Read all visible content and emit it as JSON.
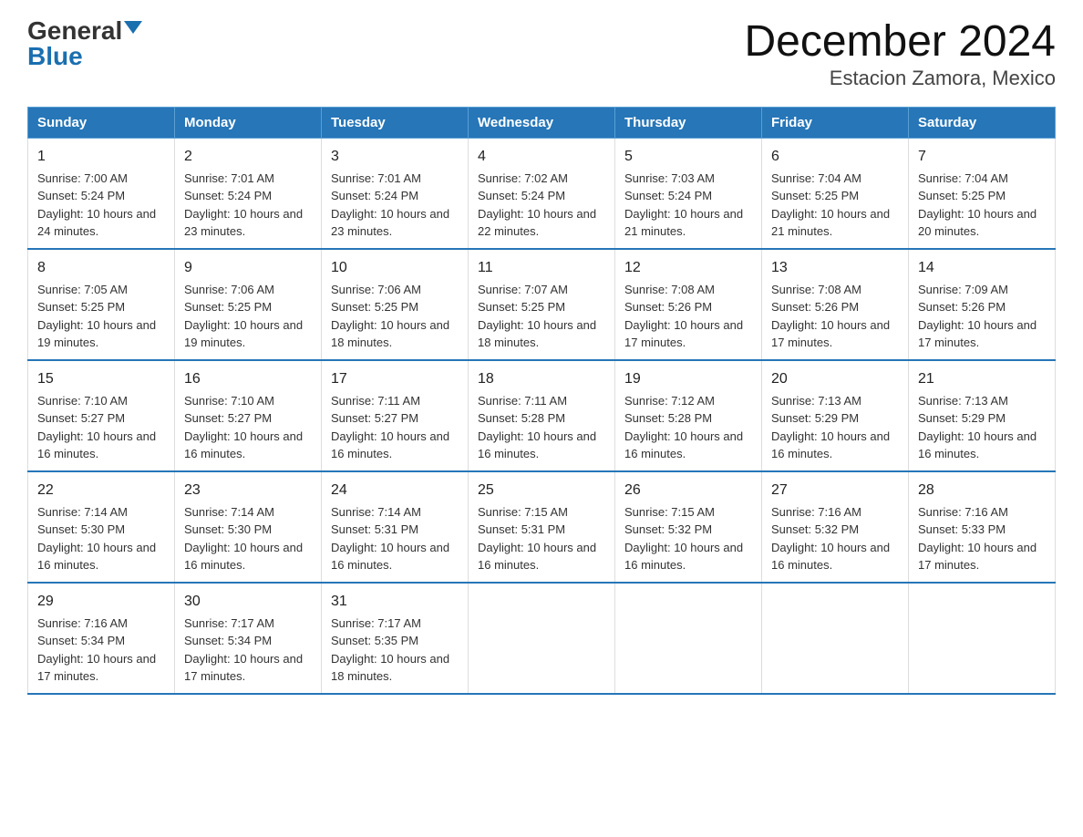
{
  "logo": {
    "general": "General",
    "blue": "Blue"
  },
  "title": "December 2024",
  "subtitle": "Estacion Zamora, Mexico",
  "days_of_week": [
    "Sunday",
    "Monday",
    "Tuesday",
    "Wednesday",
    "Thursday",
    "Friday",
    "Saturday"
  ],
  "weeks": [
    [
      {
        "day": "1",
        "sunrise": "7:00 AM",
        "sunset": "5:24 PM",
        "daylight": "10 hours and 24 minutes."
      },
      {
        "day": "2",
        "sunrise": "7:01 AM",
        "sunset": "5:24 PM",
        "daylight": "10 hours and 23 minutes."
      },
      {
        "day": "3",
        "sunrise": "7:01 AM",
        "sunset": "5:24 PM",
        "daylight": "10 hours and 23 minutes."
      },
      {
        "day": "4",
        "sunrise": "7:02 AM",
        "sunset": "5:24 PM",
        "daylight": "10 hours and 22 minutes."
      },
      {
        "day": "5",
        "sunrise": "7:03 AM",
        "sunset": "5:24 PM",
        "daylight": "10 hours and 21 minutes."
      },
      {
        "day": "6",
        "sunrise": "7:04 AM",
        "sunset": "5:25 PM",
        "daylight": "10 hours and 21 minutes."
      },
      {
        "day": "7",
        "sunrise": "7:04 AM",
        "sunset": "5:25 PM",
        "daylight": "10 hours and 20 minutes."
      }
    ],
    [
      {
        "day": "8",
        "sunrise": "7:05 AM",
        "sunset": "5:25 PM",
        "daylight": "10 hours and 19 minutes."
      },
      {
        "day": "9",
        "sunrise": "7:06 AM",
        "sunset": "5:25 PM",
        "daylight": "10 hours and 19 minutes."
      },
      {
        "day": "10",
        "sunrise": "7:06 AM",
        "sunset": "5:25 PM",
        "daylight": "10 hours and 18 minutes."
      },
      {
        "day": "11",
        "sunrise": "7:07 AM",
        "sunset": "5:25 PM",
        "daylight": "10 hours and 18 minutes."
      },
      {
        "day": "12",
        "sunrise": "7:08 AM",
        "sunset": "5:26 PM",
        "daylight": "10 hours and 17 minutes."
      },
      {
        "day": "13",
        "sunrise": "7:08 AM",
        "sunset": "5:26 PM",
        "daylight": "10 hours and 17 minutes."
      },
      {
        "day": "14",
        "sunrise": "7:09 AM",
        "sunset": "5:26 PM",
        "daylight": "10 hours and 17 minutes."
      }
    ],
    [
      {
        "day": "15",
        "sunrise": "7:10 AM",
        "sunset": "5:27 PM",
        "daylight": "10 hours and 16 minutes."
      },
      {
        "day": "16",
        "sunrise": "7:10 AM",
        "sunset": "5:27 PM",
        "daylight": "10 hours and 16 minutes."
      },
      {
        "day": "17",
        "sunrise": "7:11 AM",
        "sunset": "5:27 PM",
        "daylight": "10 hours and 16 minutes."
      },
      {
        "day": "18",
        "sunrise": "7:11 AM",
        "sunset": "5:28 PM",
        "daylight": "10 hours and 16 minutes."
      },
      {
        "day": "19",
        "sunrise": "7:12 AM",
        "sunset": "5:28 PM",
        "daylight": "10 hours and 16 minutes."
      },
      {
        "day": "20",
        "sunrise": "7:13 AM",
        "sunset": "5:29 PM",
        "daylight": "10 hours and 16 minutes."
      },
      {
        "day": "21",
        "sunrise": "7:13 AM",
        "sunset": "5:29 PM",
        "daylight": "10 hours and 16 minutes."
      }
    ],
    [
      {
        "day": "22",
        "sunrise": "7:14 AM",
        "sunset": "5:30 PM",
        "daylight": "10 hours and 16 minutes."
      },
      {
        "day": "23",
        "sunrise": "7:14 AM",
        "sunset": "5:30 PM",
        "daylight": "10 hours and 16 minutes."
      },
      {
        "day": "24",
        "sunrise": "7:14 AM",
        "sunset": "5:31 PM",
        "daylight": "10 hours and 16 minutes."
      },
      {
        "day": "25",
        "sunrise": "7:15 AM",
        "sunset": "5:31 PM",
        "daylight": "10 hours and 16 minutes."
      },
      {
        "day": "26",
        "sunrise": "7:15 AM",
        "sunset": "5:32 PM",
        "daylight": "10 hours and 16 minutes."
      },
      {
        "day": "27",
        "sunrise": "7:16 AM",
        "sunset": "5:32 PM",
        "daylight": "10 hours and 16 minutes."
      },
      {
        "day": "28",
        "sunrise": "7:16 AM",
        "sunset": "5:33 PM",
        "daylight": "10 hours and 17 minutes."
      }
    ],
    [
      {
        "day": "29",
        "sunrise": "7:16 AM",
        "sunset": "5:34 PM",
        "daylight": "10 hours and 17 minutes."
      },
      {
        "day": "30",
        "sunrise": "7:17 AM",
        "sunset": "5:34 PM",
        "daylight": "10 hours and 17 minutes."
      },
      {
        "day": "31",
        "sunrise": "7:17 AM",
        "sunset": "5:35 PM",
        "daylight": "10 hours and 18 minutes."
      },
      null,
      null,
      null,
      null
    ]
  ]
}
